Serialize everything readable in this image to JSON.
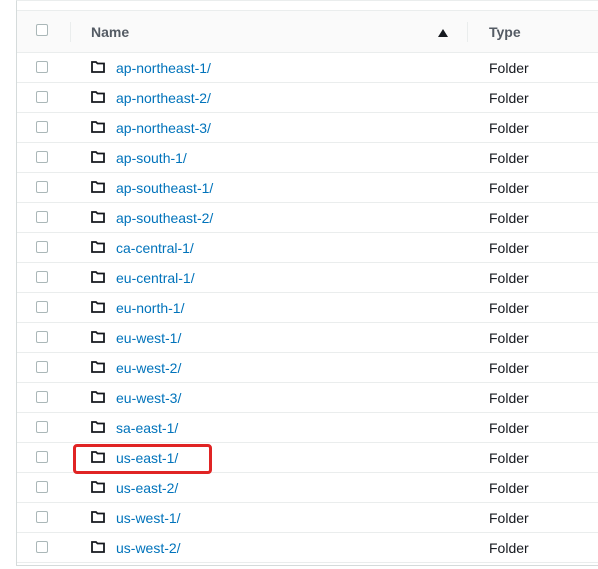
{
  "table": {
    "columns": {
      "name": "Name",
      "type": "Type"
    },
    "sort": "ascending",
    "rows": [
      {
        "name": "ap-northeast-1/",
        "type": "Folder"
      },
      {
        "name": "ap-northeast-2/",
        "type": "Folder"
      },
      {
        "name": "ap-northeast-3/",
        "type": "Folder"
      },
      {
        "name": "ap-south-1/",
        "type": "Folder"
      },
      {
        "name": "ap-southeast-1/",
        "type": "Folder"
      },
      {
        "name": "ap-southeast-2/",
        "type": "Folder"
      },
      {
        "name": "ca-central-1/",
        "type": "Folder"
      },
      {
        "name": "eu-central-1/",
        "type": "Folder"
      },
      {
        "name": "eu-north-1/",
        "type": "Folder"
      },
      {
        "name": "eu-west-1/",
        "type": "Folder"
      },
      {
        "name": "eu-west-2/",
        "type": "Folder"
      },
      {
        "name": "eu-west-3/",
        "type": "Folder"
      },
      {
        "name": "sa-east-1/",
        "type": "Folder"
      },
      {
        "name": "us-east-1/",
        "type": "Folder"
      },
      {
        "name": "us-east-2/",
        "type": "Folder"
      },
      {
        "name": "us-west-1/",
        "type": "Folder"
      },
      {
        "name": "us-west-2/",
        "type": "Folder"
      }
    ],
    "highlighted_row": "us-east-1/"
  },
  "colors": {
    "link": "#0073bb",
    "highlight": "#e02424",
    "header_bg": "#fafafa"
  },
  "icons": {
    "row": "folder-icon",
    "sort": "sort-ascending-icon"
  }
}
